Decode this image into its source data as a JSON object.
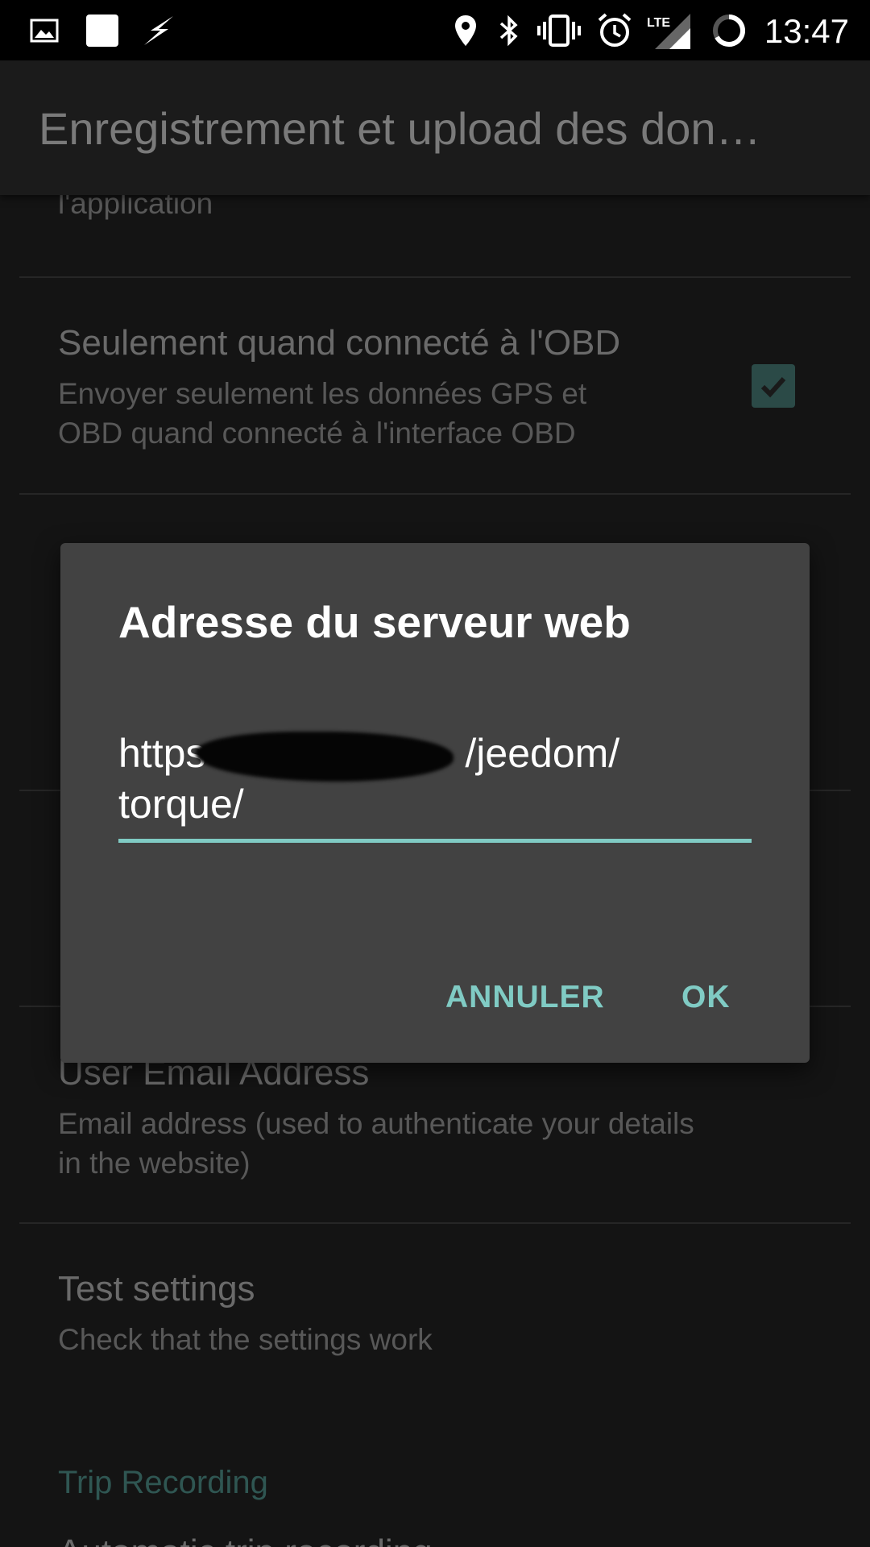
{
  "status_bar": {
    "time": "13:47",
    "left_icons": [
      "image-icon",
      "square-icon",
      "flash-icon"
    ],
    "right_icons": [
      "location-icon",
      "bluetooth-icon",
      "vibrate-icon",
      "alarm-icon",
      "lte-signal-icon",
      "battery-ring-icon"
    ],
    "lte_label": "LTE"
  },
  "app_bar": {
    "title": "Enregistrement et upload des don…"
  },
  "settings": {
    "partial_summary": "l'application",
    "obd_only": {
      "title": "Seulement quand connecté à l'OBD",
      "summary_line1": "Envoyer seulement les données GPS et",
      "summary_line2": "OBD quand connecté à l'interface OBD",
      "checked": true
    },
    "user_email": {
      "title": "User Email Address",
      "summary_line1": "Email address (used to authenticate your details",
      "summary_line2": "in the website)"
    },
    "test_settings": {
      "title": "Test settings",
      "summary": "Check that the settings work"
    },
    "category_trip": "Trip Recording",
    "partial_next_title": "Automatic trip recording"
  },
  "dialog": {
    "title": "Adresse du serveur web",
    "url_line1_start": "https",
    "url_line1_end": "/jeedom/",
    "url_line2": "torque/",
    "cancel_label": "ANNULER",
    "ok_label": "OK",
    "accent_color": "#80cbc4"
  }
}
